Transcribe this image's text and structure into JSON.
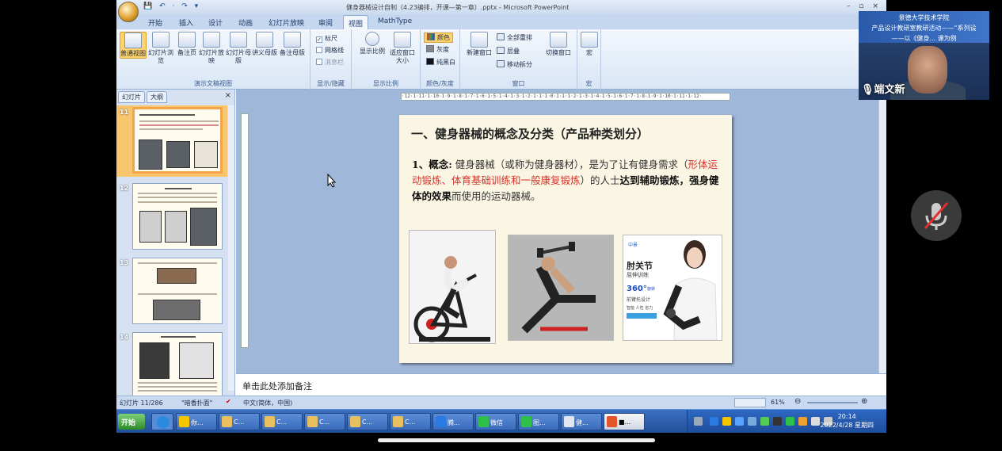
{
  "window": {
    "title": "健身器械设计自制（4.23编排，开课—第一章）.pptx - Microsoft PowerPoint",
    "controls": "– ▫ ×",
    "qat": "💾 ↶ · ↷ ▾"
  },
  "tabs": [
    "开始",
    "插入",
    "设计",
    "动画",
    "幻灯片放映",
    "审阅",
    "视图",
    "MathType"
  ],
  "active_tab": "视图",
  "ribbon": {
    "groups": {
      "views": {
        "label": "演示文稿视图",
        "buttons": [
          "普通视图",
          "幻灯片浏览",
          "备注页",
          "幻灯片放映",
          "幻灯片母版",
          "讲义母版",
          "备注母版"
        ]
      },
      "show_hide": {
        "label": "显示/隐藏",
        "checkboxes": [
          {
            "label": "标尺",
            "checked": true
          },
          {
            "label": "网格线",
            "checked": false
          },
          {
            "label": "消息栏",
            "checked": false
          }
        ]
      },
      "zoom": {
        "label": "显示比例",
        "buttons": [
          "显示比例",
          "适应窗口大小"
        ]
      },
      "color": {
        "label": "颜色/灰度",
        "items": [
          "颜色",
          "灰度",
          "纯黑白"
        ]
      },
      "window": {
        "label": "窗口",
        "new_window": "新建窗口",
        "items": [
          "全部重排",
          "层叠",
          "移动拆分"
        ],
        "switch": "切换窗口"
      },
      "macro": {
        "label": "宏",
        "button": "宏"
      }
    }
  },
  "panel": {
    "tabs": [
      "幻灯片",
      "大纲"
    ],
    "close": "×",
    "thumbnails": [
      {
        "num": "11",
        "selected": true
      },
      {
        "num": "12",
        "selected": false
      },
      {
        "num": "13",
        "selected": false
      },
      {
        "num": "14",
        "selected": false
      }
    ]
  },
  "ruler": {
    "horizontal": "·12·1·11·1·10·1·9·1·8·1·7·1·6·1·5·1·4·1·3·1·2·1·1·1·0·1·1·1·2·1·3·1·4·1·5·1·6·1·7·1·8·1·9·1·10·1·11·1·12·"
  },
  "slide": {
    "title": "一、健身器械的概念及分类（产品种类划分）",
    "lead_bold": "1、概念:",
    "text1": " 健身器械（或称为健身器材），是为了让有健身需求（",
    "red_text": "形体运动锻炼、体育基础训练和一般康复锻炼",
    "text2": "）的人士",
    "bold2": "达到辅助锻炼，强身健体的效果",
    "text3": "而使用的运动器械。",
    "ad": {
      "brand": "中景",
      "headline": "肘关节",
      "sub": "屈伸训练",
      "deg": "360°",
      "deg_note": "旋转",
      "feat": "前臂托设计",
      "tags": "智能 人性 省力"
    }
  },
  "notes": {
    "placeholder": "单击此处添加备注"
  },
  "status": {
    "slide_pos": "幻灯片 11/286",
    "theme": "\"暗香扑面\"",
    "lang": "中文(简体，中国)",
    "zoom": "61%"
  },
  "taskbar": {
    "start": "开始",
    "items": [
      "你...",
      "C...",
      "C...",
      "C...",
      "C...",
      "C...",
      "腾...",
      "微信",
      "图...",
      "健...",
      "■..."
    ],
    "active_index": 10,
    "time": "20:14",
    "date": "2022/4/28 星期四"
  },
  "video": {
    "banner_line1": "景德大学技术学院",
    "banner_line2": "产品设计教研室教研活动——“系列设",
    "banner_line3": "——以《健身... 课为例",
    "name": "端文新"
  },
  "colors": {
    "accent_red": "#d8332a",
    "slide_bg": "#fbf6e4",
    "selected_thumb": "#f3a54a"
  }
}
